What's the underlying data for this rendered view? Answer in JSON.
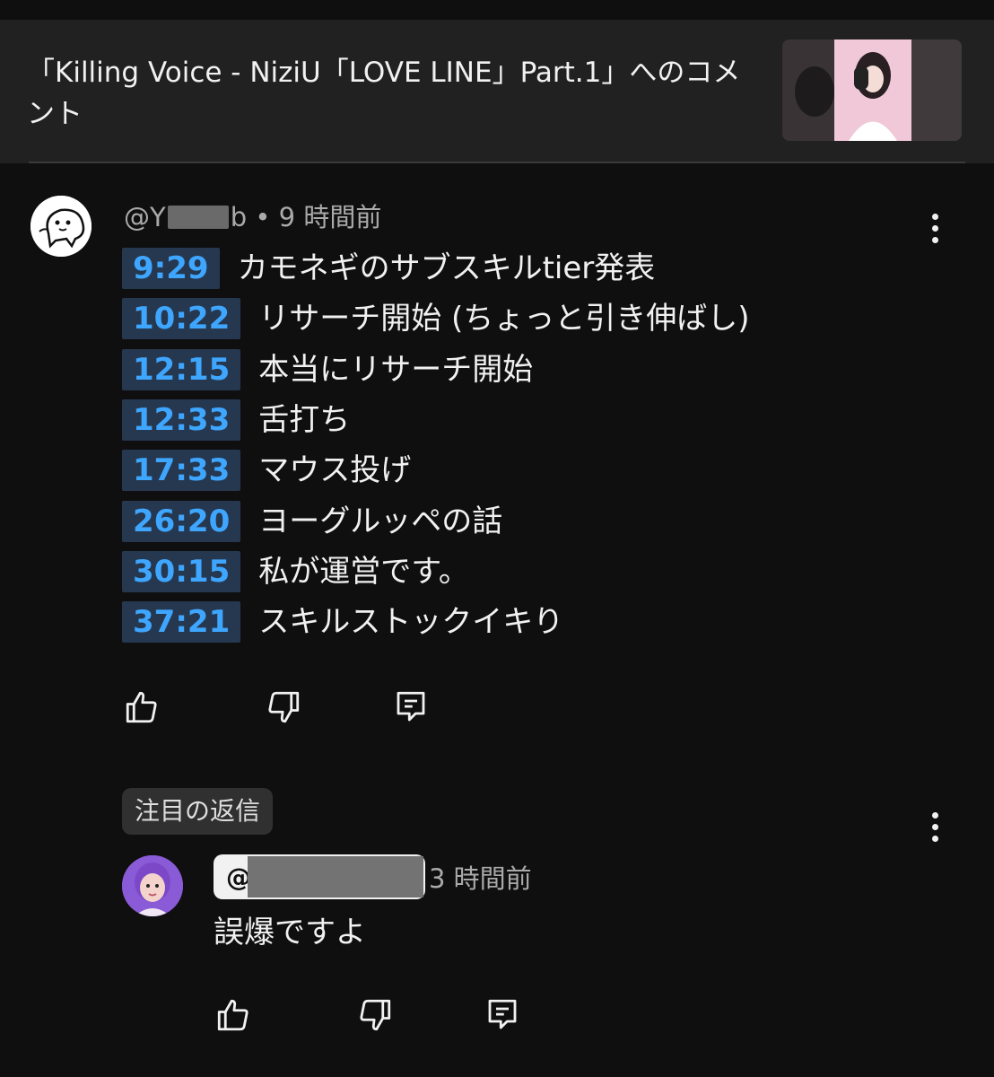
{
  "header": {
    "title": "「Killing Voice - NiziU「LOVE LINE」Part.1」へのコメント"
  },
  "comment": {
    "author_prefix": "@Y",
    "author_suffix": "b",
    "time": "• 9 時間前",
    "timestamps": [
      {
        "time": "9:29",
        "label": "カモネギのサブスキルtier発表"
      },
      {
        "time": "10:22",
        "label": "リサーチ開始 (ちょっと引き伸ばし)"
      },
      {
        "time": "12:15",
        "label": "本当にリサーチ開始"
      },
      {
        "time": "12:33",
        "label": "舌打ち"
      },
      {
        "time": "17:33",
        "label": "マウス投げ"
      },
      {
        "time": "26:20",
        "label": "ヨーグルッペの話"
      },
      {
        "time": "30:15",
        "label": "私が運営です。"
      },
      {
        "time": "37:21",
        "label": "スキルストックイキり"
      }
    ]
  },
  "replies": {
    "chip_label": "注目の返信"
  },
  "reply": {
    "author_at": "@",
    "time": "3 時間前",
    "text": "誤爆ですよ"
  },
  "icons": {
    "like": "thumbs-up-icon",
    "dislike": "thumbs-down-icon",
    "reply": "comment-icon",
    "menu": "more-vertical-icon"
  }
}
